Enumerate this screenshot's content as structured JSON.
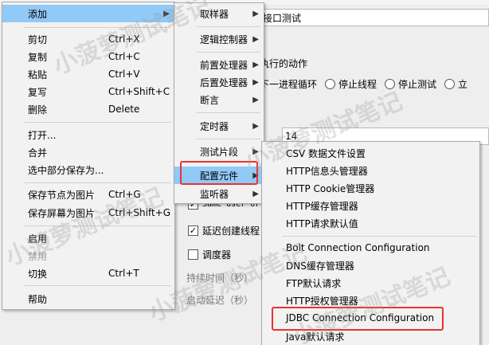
{
  "background": {
    "name_value": "接口测试",
    "action_title": "执行的动作",
    "radios": [
      "下一进程循环",
      "停止线程",
      "停止测试",
      "立"
    ],
    "number_value": "14",
    "checkbox_same_user": "Same user or",
    "checkbox_delay": "延迟创建线程",
    "checkbox_scheduler": "调度器",
    "duration_label": "持续时间（秒）",
    "startup_delay_label": "启动延迟（秒）"
  },
  "context_menu": {
    "items": [
      {
        "label": "添加",
        "shortcut": "",
        "submenu": true
      },
      {
        "label": "剪切",
        "shortcut": "Ctrl+X"
      },
      {
        "label": "复制",
        "shortcut": "Ctrl+C"
      },
      {
        "label": "粘贴",
        "shortcut": "Ctrl+V"
      },
      {
        "label": "复写",
        "shortcut": "Ctrl+Shift+C"
      },
      {
        "label": "删除",
        "shortcut": "Delete"
      },
      {
        "label": "打开...",
        "shortcut": ""
      },
      {
        "label": "合并",
        "shortcut": ""
      },
      {
        "label": "选中部分保存为...",
        "shortcut": ""
      },
      {
        "label": "保存节点为图片",
        "shortcut": "Ctrl+G"
      },
      {
        "label": "保存屏幕为图片",
        "shortcut": "Ctrl+Shift+G"
      },
      {
        "label": "启用",
        "shortcut": ""
      },
      {
        "label": "禁用",
        "shortcut": ""
      },
      {
        "label": "切换",
        "shortcut": "Ctrl+T"
      },
      {
        "label": "帮助",
        "shortcut": ""
      }
    ]
  },
  "add_submenu": {
    "items": [
      {
        "label": "取样器"
      },
      {
        "label": "逻辑控制器"
      },
      {
        "label": "前置处理器"
      },
      {
        "label": "后置处理器"
      },
      {
        "label": "断言"
      },
      {
        "label": "定时器"
      },
      {
        "label": "测试片段"
      },
      {
        "label": "配置元件"
      },
      {
        "label": "监听器"
      }
    ]
  },
  "config_submenu": {
    "items": [
      {
        "label": "CSV 数据文件设置"
      },
      {
        "label": "HTTP信息头管理器"
      },
      {
        "label": "HTTP Cookie管理器"
      },
      {
        "label": "HTTP缓存管理器"
      },
      {
        "label": "HTTP请求默认值"
      },
      {
        "label": "Bolt Connection Configuration"
      },
      {
        "label": "DNS缓存管理器"
      },
      {
        "label": "FTP默认请求"
      },
      {
        "label": "HTTP授权管理器"
      },
      {
        "label": "JDBC Connection Configuration"
      },
      {
        "label": "Java默认请求"
      }
    ]
  },
  "watermark": "小菠萝测试笔记",
  "colors": {
    "hover": "#91c9f7",
    "highlight": "#e8342f",
    "menu_bg": "#f2f2f2"
  }
}
